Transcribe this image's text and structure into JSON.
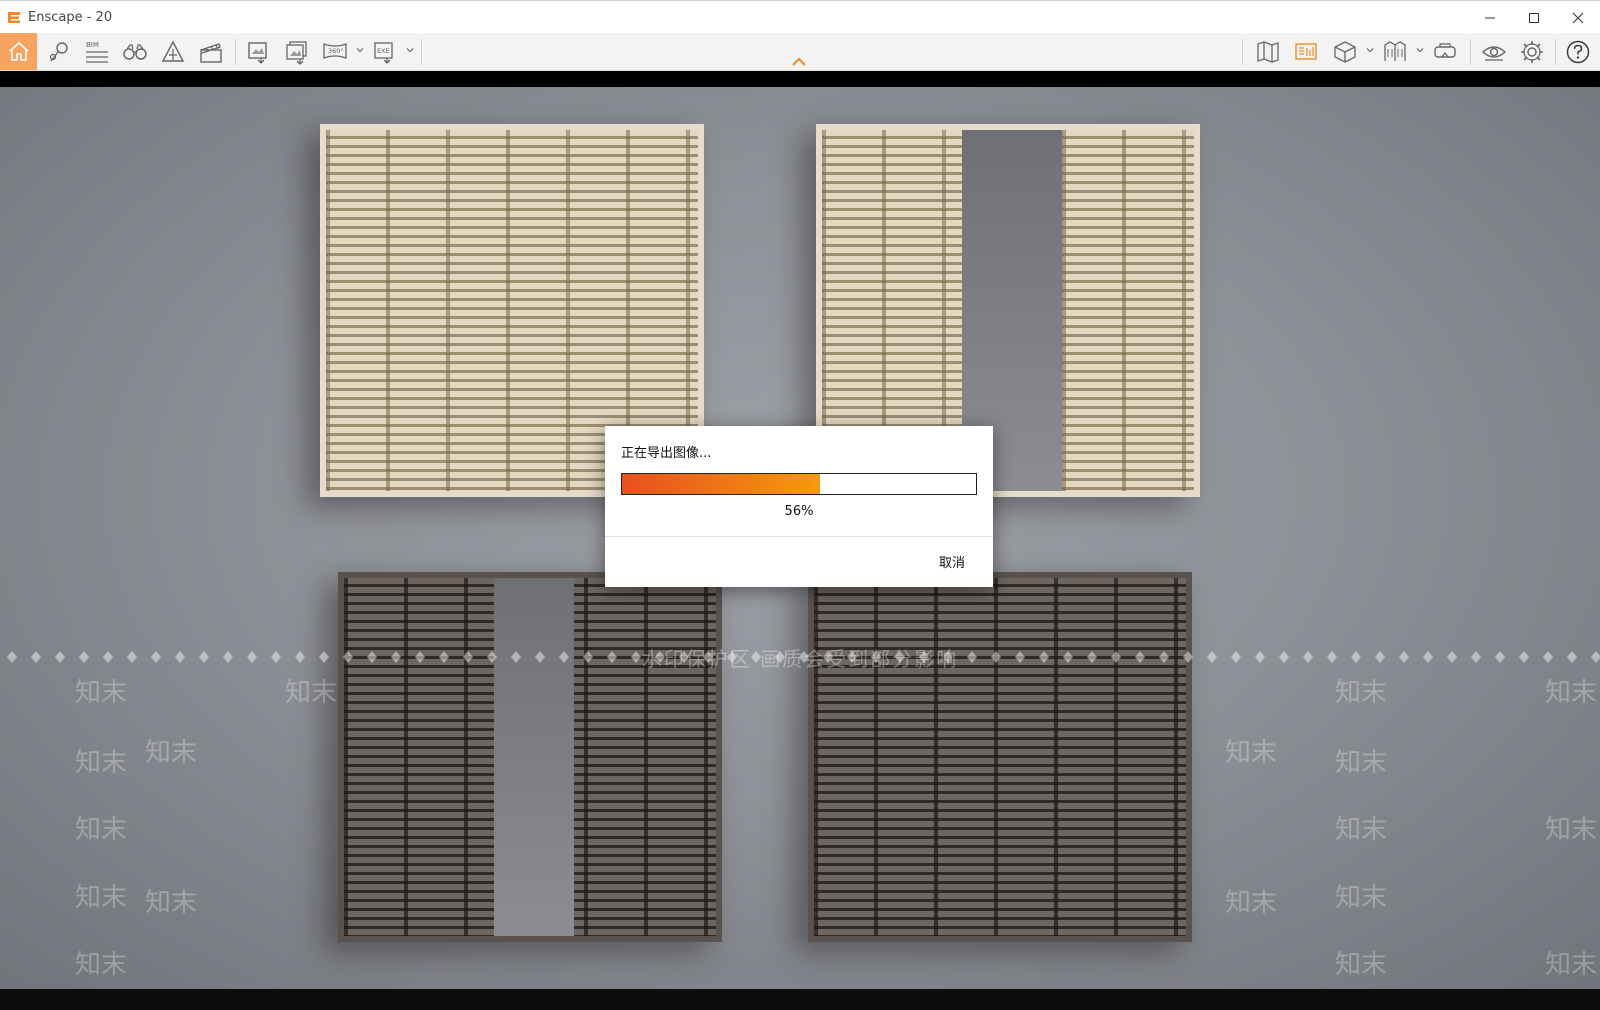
{
  "window": {
    "title": "Enscape - 20",
    "accent_color": "#f5a35f"
  },
  "toolbar": {
    "left_icons": [
      "home-icon",
      "location-pin-icon",
      "bim-icon",
      "binoculars-icon",
      "section-icon",
      "clapperboard-icon",
      "render-image-icon",
      "batch-render-icon",
      "panorama-360-icon",
      "export-exe-icon"
    ],
    "bim_label": "BIM",
    "panorama_label": "360°",
    "exe_label": "EXE",
    "right_icons": [
      "map-icon",
      "asset-library-icon",
      "cube-view-icon",
      "light-views-icon",
      "vr-headset-icon",
      "visibility-icon",
      "settings-icon",
      "help-icon"
    ]
  },
  "viewport": {
    "watermark_text": "水印保护区   画质会受到部分影响",
    "watermark_tile": "知末"
  },
  "export_dialog": {
    "title": "正在导出图像...",
    "progress": 0.56,
    "progress_label": "56%",
    "cancel_label": "取消",
    "fill_colors": [
      "#e8501f",
      "#f59a0c"
    ]
  }
}
